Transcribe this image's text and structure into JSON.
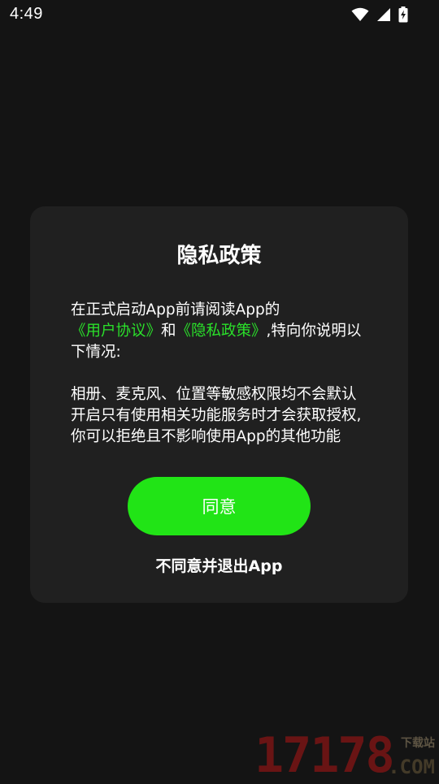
{
  "status_bar": {
    "time": "4:49",
    "icons": [
      "wifi-icon",
      "signal-icon",
      "battery-charging-icon"
    ]
  },
  "dialog": {
    "title": "隐私政策",
    "intro_before": "在正式启动App前请阅读App的",
    "user_agreement_link": "《用户协议》",
    "conjunction": "和",
    "privacy_policy_link": "《隐私政策》",
    "intro_after": ",特向你说明以下情况:",
    "permissions_text": "相册、麦克风、位置等敏感权限均不会默认开启只有使用相关功能服务时才会获取授权,你可以拒绝且不影响使用App的其他功能",
    "agree_label": "同意",
    "decline_label": "不同意并退出App"
  },
  "watermark": {
    "number": "17178",
    "subtitle": "下载站",
    "domain": ".COM"
  },
  "colors": {
    "background": "#141414",
    "dialog_background": "#202020",
    "accent_green": "#21e416",
    "link_green": "#2ae02a"
  }
}
